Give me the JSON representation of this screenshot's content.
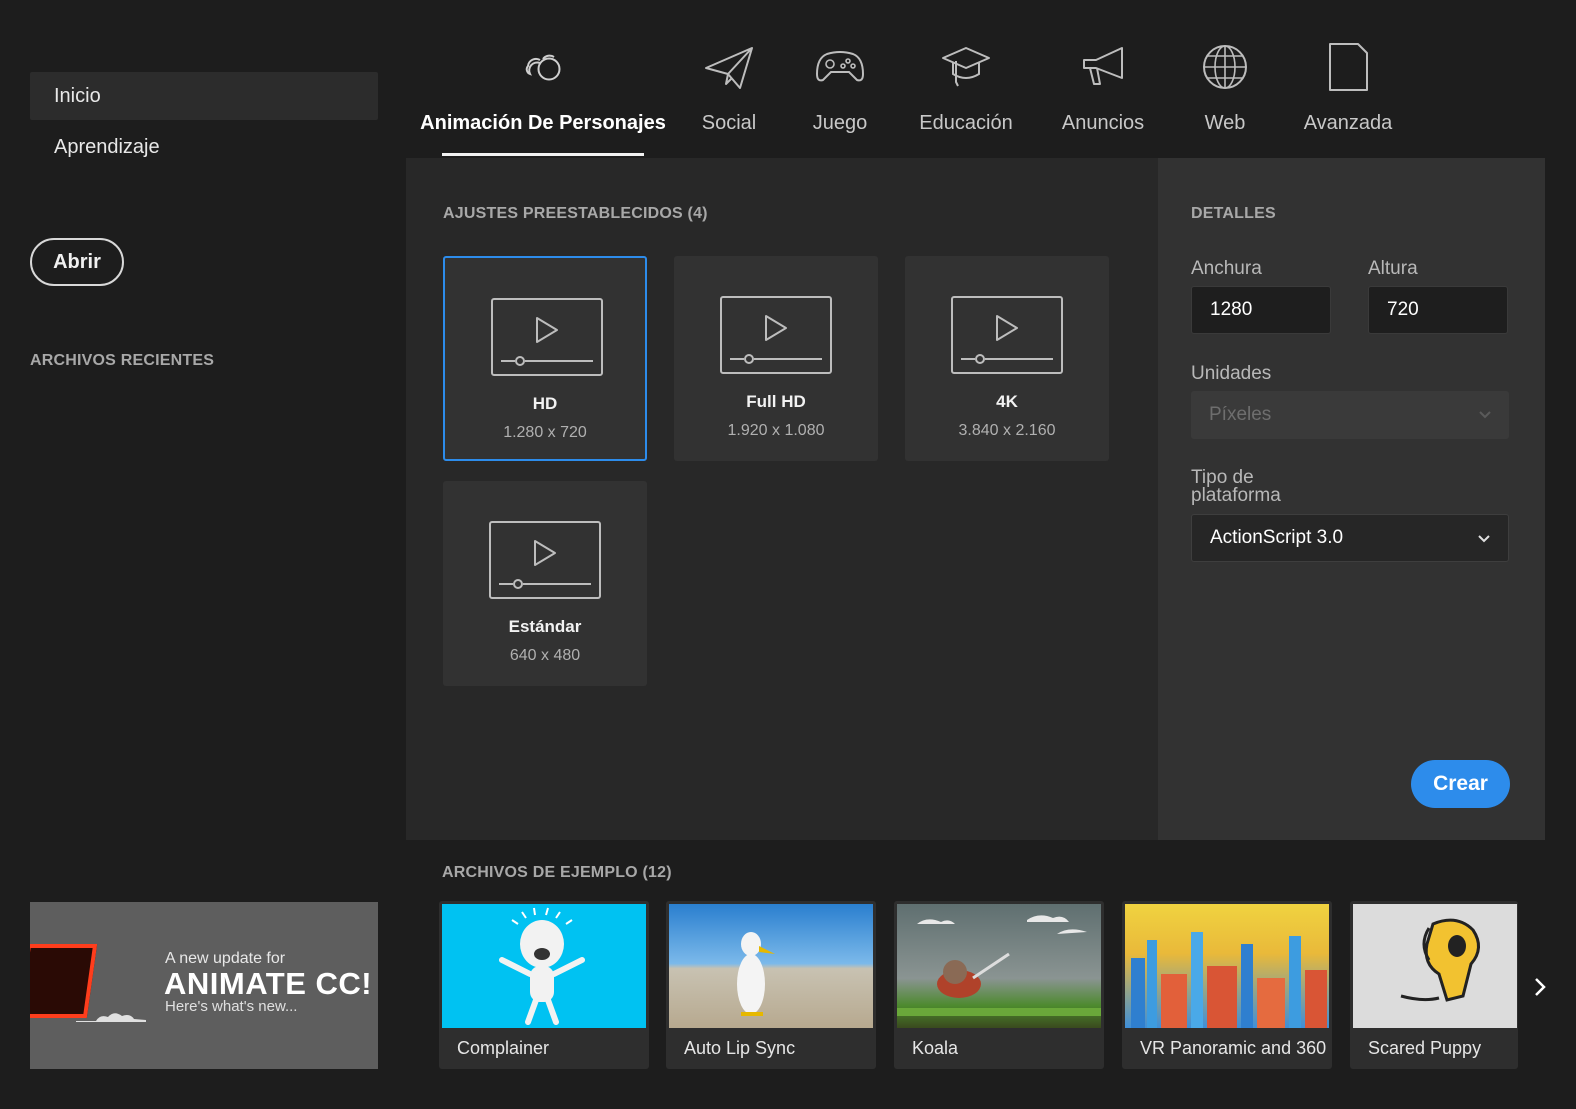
{
  "sidebar": {
    "items": [
      {
        "label": "Inicio"
      },
      {
        "label": "Aprendizaje"
      }
    ],
    "open_button": "Abrir",
    "recent_files_title": "ARCHIVOS RECIENTES"
  },
  "promo": {
    "line1": "A new update for",
    "line2": "ANIMATE CC!",
    "line3": "Here's what's new...",
    "accent_color": "#ff3d1c"
  },
  "tabs": [
    {
      "label": "Animación De Personajes",
      "icon": "character-animation-icon",
      "active": true
    },
    {
      "label": "Social",
      "icon": "paper-plane-icon"
    },
    {
      "label": "Juego",
      "icon": "gamepad-icon"
    },
    {
      "label": "Educación",
      "icon": "graduation-cap-icon"
    },
    {
      "label": "Anuncios",
      "icon": "megaphone-icon"
    },
    {
      "label": "Web",
      "icon": "globe-icon"
    },
    {
      "label": "Avanzada",
      "icon": "document-icon"
    }
  ],
  "presets": {
    "title": "AJUSTES PREESTABLECIDOS (4)",
    "items": [
      {
        "name": "HD",
        "size": "1.280 x 720",
        "selected": true
      },
      {
        "name": "Full HD",
        "size": "1.920 x 1.080"
      },
      {
        "name": "4K",
        "size": "3.840 x 2.160"
      },
      {
        "name": "Estándar",
        "size": "640 x 480"
      }
    ]
  },
  "details": {
    "title": "DETALLES",
    "width_label": "Anchura",
    "width_value": "1280",
    "height_label": "Altura",
    "height_value": "720",
    "units_label": "Unidades",
    "units_value": "Píxeles",
    "platform_label_line1": "Tipo de",
    "platform_label_line2": "plataforma",
    "platform_value": "ActionScript 3.0",
    "create_button": "Crear"
  },
  "samples": {
    "title": "ARCHIVOS DE EJEMPLO (12)",
    "items": [
      {
        "label": "Complainer"
      },
      {
        "label": "Auto Lip Sync"
      },
      {
        "label": "Koala"
      },
      {
        "label": "VR Panoramic and 360 ..."
      },
      {
        "label": "Scared Puppy"
      }
    ]
  },
  "colors": {
    "accent": "#2d8ceb",
    "background": "#1d1d1d"
  }
}
